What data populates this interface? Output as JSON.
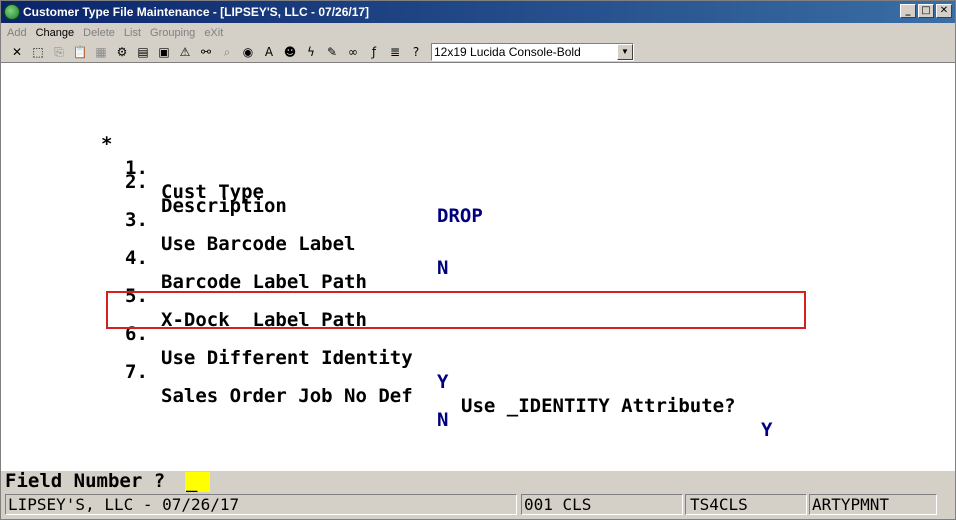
{
  "window": {
    "title": "Customer Type File Maintenance - [LIPSEY'S, LLC - 07/26/17]",
    "minimize": "_",
    "maximize": "□",
    "close": "✕"
  },
  "menu": [
    "Add",
    "Change",
    "Delete",
    "List",
    "Grouping",
    "eXit"
  ],
  "menu_active": "Change",
  "toolbar": {
    "font_select": "12x19 Lucida Console-Bold",
    "icons": [
      "close-x-icon",
      "select-icon",
      "copy-icon",
      "paste-icon",
      "calculator-icon",
      "settings-icon",
      "script-icon",
      "shell-icon",
      "warning-icon",
      "binoculars-icon",
      "search-icon",
      "globe-icon",
      "font-icon",
      "user-icon",
      "lightning-icon",
      "edit-icon",
      "link-icon",
      "function-icon",
      "list-icon",
      "help-icon"
    ]
  },
  "fields": [
    {
      "marker": "*",
      "num": "1.",
      "label": "Cust Type",
      "value": "DROP"
    },
    {
      "marker": "",
      "num": "2.",
      "label": "Description",
      "value": ""
    },
    {
      "marker": "",
      "num": "3.",
      "label": "Use Barcode Label",
      "value": "N"
    },
    {
      "marker": "",
      "num": "4.",
      "label": "Barcode Label Path",
      "value": ""
    },
    {
      "marker": "",
      "num": "5.",
      "label": "X-Dock  Label Path",
      "value": ""
    },
    {
      "marker": "",
      "num": "6.",
      "label": "Use Different Identity",
      "value": "Y",
      "extra_label": "Use _IDENTITY Attribute?",
      "extra_value": "Y"
    },
    {
      "marker": "",
      "num": "7.",
      "label": "Sales Order Job No Def",
      "value": "N"
    }
  ],
  "prompt": {
    "label": "Field Number ?",
    "value": "_"
  },
  "status": {
    "company": "LIPSEY'S, LLC - 07/26/17",
    "code": "001 CLS",
    "terminal": "TS4CLS",
    "program": "ARTYPMNT"
  }
}
